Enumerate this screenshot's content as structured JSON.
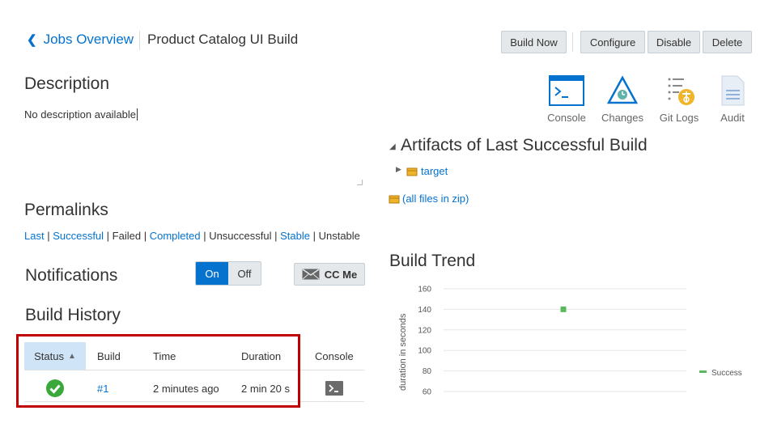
{
  "header": {
    "back_label": "Jobs Overview",
    "title": "Product Catalog UI Build",
    "buttons": {
      "build_now": "Build Now",
      "configure": "Configure",
      "disable": "Disable",
      "delete": "Delete"
    }
  },
  "description": {
    "heading": "Description",
    "text": "No description available"
  },
  "quick_links": [
    {
      "label": "Console",
      "icon": "console-icon"
    },
    {
      "label": "Changes",
      "icon": "changes-icon"
    },
    {
      "label": "Git Logs",
      "icon": "git-logs-icon"
    },
    {
      "label": "Audit",
      "icon": "audit-icon"
    }
  ],
  "artifacts": {
    "heading": "Artifacts of Last Successful Build",
    "items": [
      "target"
    ],
    "zip_label": "(all files in zip)"
  },
  "permalinks": {
    "heading": "Permalinks",
    "links": [
      {
        "label": "Last",
        "active": true
      },
      {
        "label": "Successful",
        "active": true
      },
      {
        "label": "Failed",
        "active": false
      },
      {
        "label": "Completed",
        "active": true
      },
      {
        "label": "Unsuccessful",
        "active": false
      },
      {
        "label": "Stable",
        "active": true
      },
      {
        "label": "Unstable",
        "active": false
      }
    ]
  },
  "notifications": {
    "heading": "Notifications",
    "on_label": "On",
    "off_label": "Off",
    "cc_me_label": "CC Me",
    "state": "On"
  },
  "build_history": {
    "heading": "Build History",
    "columns": [
      "Status",
      "Build",
      "Time",
      "Duration",
      "Console"
    ],
    "rows": [
      {
        "status": "success",
        "build": "#1",
        "time": "2 minutes ago",
        "duration": "2 min 20 s"
      }
    ]
  },
  "colors": {
    "accent": "#0572ce",
    "success": "#2e9e2e",
    "trend_point": "#5cb85c",
    "highlight": "#c00000"
  },
  "chart_data": {
    "type": "scatter",
    "title": "Build Trend",
    "ylabel": "duration in seconds",
    "ylim": [
      60,
      160
    ],
    "yticks": [
      60,
      80,
      100,
      120,
      140,
      160
    ],
    "series": [
      {
        "name": "Success",
        "color": "#5cb85c",
        "values": [
          {
            "build": 1,
            "y": 140
          }
        ]
      }
    ],
    "legend": "right",
    "grid": true
  }
}
